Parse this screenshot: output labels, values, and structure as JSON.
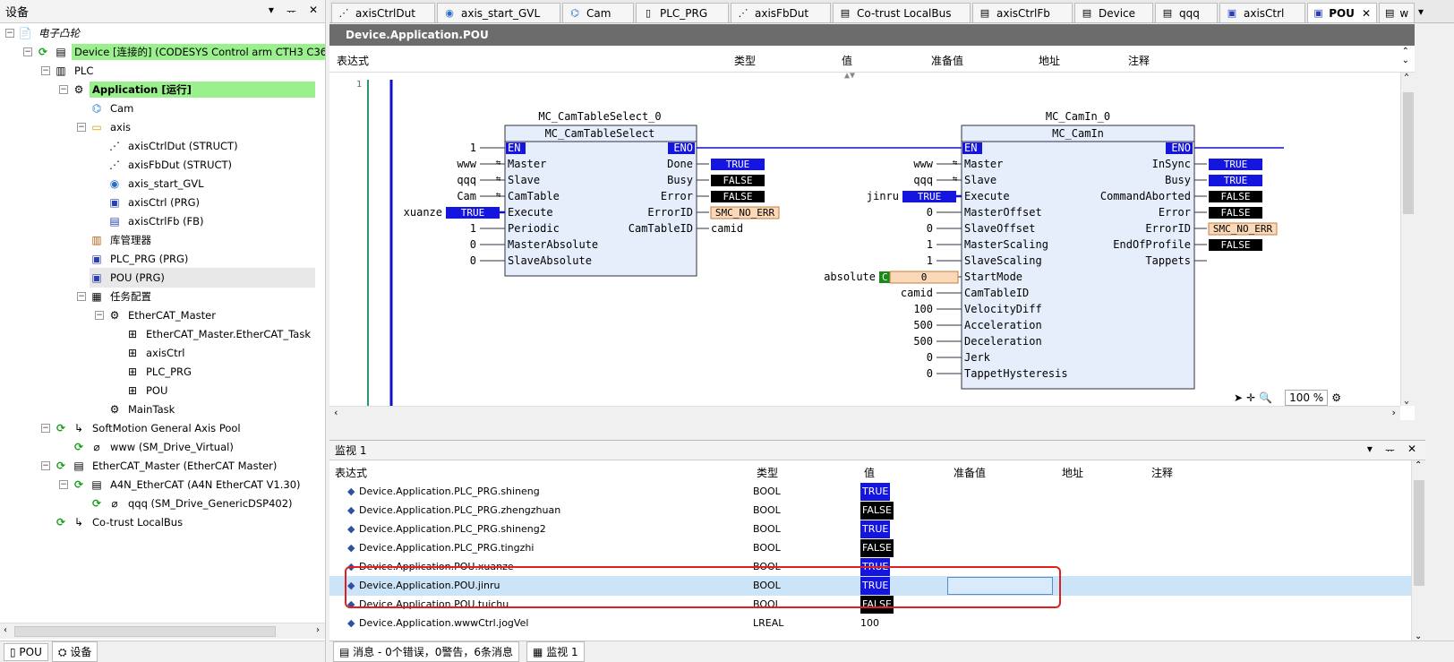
{
  "left_panel": {
    "title": "设备",
    "tree": [
      {
        "label": "电子凸轮"
      },
      {
        "label": "Device [连接的] (CODESYS Control arm CTH3 C36-001S"
      },
      {
        "label": "PLC"
      },
      {
        "label": "Application [运行]"
      },
      {
        "label": "Cam"
      },
      {
        "label": "axis"
      },
      {
        "label": "axisCtrlDut (STRUCT)"
      },
      {
        "label": "axisFbDut (STRUCT)"
      },
      {
        "label": "axis_start_GVL"
      },
      {
        "label": "axisCtrl (PRG)"
      },
      {
        "label": "axisCtrlFb (FB)"
      },
      {
        "label": "库管理器"
      },
      {
        "label": "PLC_PRG (PRG)"
      },
      {
        "label": "POU (PRG)"
      },
      {
        "label": "任务配置"
      },
      {
        "label": "EtherCAT_Master"
      },
      {
        "label": "EtherCAT_Master.EtherCAT_Task"
      },
      {
        "label": "axisCtrl"
      },
      {
        "label": "PLC_PRG"
      },
      {
        "label": "POU"
      },
      {
        "label": "MainTask"
      },
      {
        "label": "SoftMotion General Axis Pool"
      },
      {
        "label": "www (SM_Drive_Virtual)"
      },
      {
        "label": "EtherCAT_Master (EtherCAT Master)"
      },
      {
        "label": "A4N_EtherCAT (A4N EtherCAT V1.30)"
      },
      {
        "label": "qqq (SM_Drive_GenericDSP402)"
      },
      {
        "label": "Co-trust LocalBus"
      }
    ],
    "bottom_tabs": [
      "POU",
      "设备"
    ]
  },
  "tabs": [
    "axisCtrlDut",
    "axis_start_GVL",
    "Cam",
    "PLC_PRG",
    "axisFbDut",
    "Co-trust LocalBus",
    "axisCtrlFb",
    "Device",
    "qqq",
    "axisCtrl",
    "POU",
    "w"
  ],
  "editor": {
    "title": "Device.Application.POU",
    "columns": [
      "表达式",
      "类型",
      "值",
      "准备值",
      "地址",
      "注释"
    ],
    "line_no": "1",
    "zoom": "100 %",
    "fb1": {
      "instance": "MC_CamTableSelect_0",
      "type": "MC_CamTableSelect",
      "inputs": [
        "EN",
        "Master",
        "Slave",
        "CamTable",
        "Execute",
        "Periodic",
        "MasterAbsolute",
        "SlaveAbsolute"
      ],
      "outputs": [
        "ENO",
        "Done",
        "Busy",
        "Error",
        "ErrorID",
        "CamTableID"
      ],
      "in_vals": [
        "1",
        "www",
        "qqq",
        "Cam",
        "xuanze",
        "1",
        "0",
        "0"
      ],
      "out_vals": [
        "",
        "TRUE",
        "FALSE",
        "FALSE",
        "SMC_NO_ERR",
        "camid"
      ]
    },
    "fb2": {
      "instance": "MC_CamIn_0",
      "type": "MC_CamIn",
      "inputs": [
        "EN",
        "Master",
        "Slave",
        "Execute",
        "MasterOffset",
        "SlaveOffset",
        "MasterScaling",
        "SlaveScaling",
        "StartMode",
        "CamTableID",
        "VelocityDiff",
        "Acceleration",
        "Deceleration",
        "Jerk",
        "TappetHysteresis"
      ],
      "outputs": [
        "ENO",
        "InSync",
        "Busy",
        "CommandAborted",
        "Error",
        "ErrorID",
        "EndOfProfile",
        "Tappets"
      ],
      "in_vals": [
        "",
        "www",
        "qqq",
        "jinru",
        "0",
        "0",
        "1",
        "1",
        "absolute",
        "camid",
        "100",
        "500",
        "500",
        "0",
        "0"
      ],
      "out_vals": [
        "",
        "TRUE",
        "TRUE",
        "FALSE",
        "FALSE",
        "SMC_NO_ERR",
        "FALSE",
        ""
      ]
    },
    "in_true": "TRUE",
    "startmode_val": "0",
    "startmode_c": "C"
  },
  "watch": {
    "title": "监视 1",
    "columns": [
      "表达式",
      "类型",
      "值",
      "准备值",
      "地址",
      "注释"
    ],
    "rows": [
      {
        "expr": "Device.Application.PLC_PRG.shineng",
        "type": "BOOL",
        "value": "TRUE"
      },
      {
        "expr": "Device.Application.PLC_PRG.zhengzhuan",
        "type": "BOOL",
        "value": "FALSE"
      },
      {
        "expr": "Device.Application.PLC_PRG.shineng2",
        "type": "BOOL",
        "value": "TRUE"
      },
      {
        "expr": "Device.Application.PLC_PRG.tingzhi",
        "type": "BOOL",
        "value": "FALSE"
      },
      {
        "expr": "Device.Application.POU.xuanze",
        "type": "BOOL",
        "value": "TRUE"
      },
      {
        "expr": "Device.Application.POU.jinru",
        "type": "BOOL",
        "value": "TRUE"
      },
      {
        "expr": "Device.Application.POU.tuichu",
        "type": "BOOL",
        "value": "FALSE"
      },
      {
        "expr": "Device.Application.wwwCtrl.jogVel",
        "type": "LREAL",
        "value": "100"
      }
    ]
  },
  "statusbar": {
    "messages": "消息 - 0个错误，0警告，6条消息",
    "watch_tab": "监视 1"
  },
  "colors": {
    "true_bg": "#1515e0",
    "false_bg": "#000000",
    "highlight_green": "#99f08c",
    "selection": "#cce4f7",
    "annotation": "#e02020"
  }
}
